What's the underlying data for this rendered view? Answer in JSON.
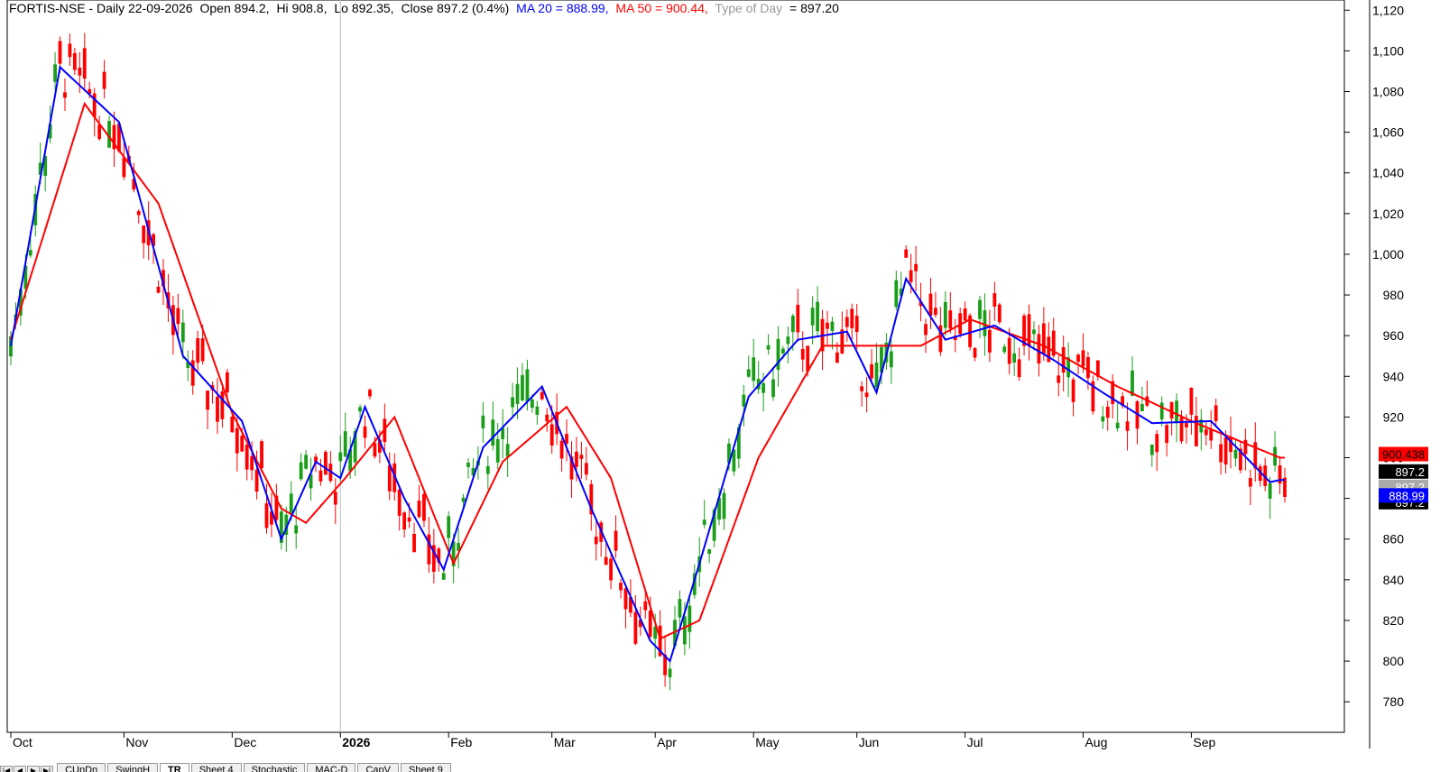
{
  "header": {
    "symbol": "FORTIS-NSE - Daily 22-09-2026",
    "open": "Open 894.2,",
    "high": "Hi 908.8,",
    "low": "Lo 892.35,",
    "close": "Close 897.2 (0.4%)",
    "ma20": "MA 20 = 888.99,",
    "ma50": "MA 50 = 900.44,",
    "tod_label": "Type of Day",
    "tod_value": "= 897.20"
  },
  "colors": {
    "up": "#1a9e1a",
    "down": "#ff0000",
    "ma20": "#0000ff",
    "ma50": "#ff0000",
    "axis": "#000000",
    "tod": "#999999"
  },
  "tabs": [
    "CUpDn",
    "SwingH",
    "TR",
    "Sheet 4",
    "Stochastic",
    "MAC-D",
    "CapV",
    "Sheet 9"
  ],
  "chart_data": {
    "type": "candlestick",
    "title": "FORTIS-NSE - Daily 22-09-2026",
    "ylim": [
      765,
      1125
    ],
    "y_ticks": [
      780,
      800,
      820,
      840,
      860,
      880,
      900,
      920,
      940,
      960,
      980,
      1000,
      1020,
      1040,
      1060,
      1080,
      1100,
      1120
    ],
    "y_tick_labels": [
      "780",
      "800",
      "820",
      "840",
      "860",
      "880",
      "900",
      "920",
      "940",
      "960",
      "980",
      "1,000",
      "1,020",
      "1,040",
      "1,060",
      "1,080",
      "1,100",
      "1,120"
    ],
    "x_month_labels": [
      {
        "label": "Oct",
        "index": 0
      },
      {
        "label": "Nov",
        "index": 23
      },
      {
        "label": "Dec",
        "index": 45
      },
      {
        "label": "2026",
        "index": 67
      },
      {
        "label": "Feb",
        "index": 89
      },
      {
        "label": "Mar",
        "index": 110
      },
      {
        "label": "Apr",
        "index": 131
      },
      {
        "label": "May",
        "index": 151
      },
      {
        "label": "Jun",
        "index": 172
      },
      {
        "label": "Jul",
        "index": 194
      },
      {
        "label": "Aug",
        "index": 218
      },
      {
        "label": "Sep",
        "index": 240
      }
    ],
    "ma_keypoints": {
      "ma20": [
        [
          0,
          955
        ],
        [
          10,
          1092
        ],
        [
          22,
          1065
        ],
        [
          35,
          950
        ],
        [
          47,
          918
        ],
        [
          55,
          860
        ],
        [
          62,
          898
        ],
        [
          67,
          890
        ],
        [
          72,
          925
        ],
        [
          80,
          880
        ],
        [
          88,
          845
        ],
        [
          96,
          905
        ],
        [
          108,
          935
        ],
        [
          118,
          875
        ],
        [
          130,
          810
        ],
        [
          134,
          800
        ],
        [
          140,
          848
        ],
        [
          150,
          930
        ],
        [
          160,
          958
        ],
        [
          170,
          962
        ],
        [
          176,
          932
        ],
        [
          182,
          988
        ],
        [
          190,
          958
        ],
        [
          200,
          965
        ],
        [
          212,
          948
        ],
        [
          222,
          932
        ],
        [
          232,
          917
        ],
        [
          244,
          918
        ],
        [
          256,
          888
        ],
        [
          258,
          889
        ]
      ],
      "ma50": [
        [
          0,
          958
        ],
        [
          15,
          1074
        ],
        [
          30,
          1025
        ],
        [
          45,
          922
        ],
        [
          55,
          875
        ],
        [
          60,
          868
        ],
        [
          68,
          890
        ],
        [
          78,
          920
        ],
        [
          90,
          848
        ],
        [
          100,
          898
        ],
        [
          113,
          925
        ],
        [
          122,
          890
        ],
        [
          132,
          811
        ],
        [
          140,
          820
        ],
        [
          152,
          900
        ],
        [
          165,
          955
        ],
        [
          175,
          955
        ],
        [
          185,
          955
        ],
        [
          195,
          968
        ],
        [
          210,
          955
        ],
        [
          225,
          935
        ],
        [
          240,
          918
        ],
        [
          258,
          900
        ]
      ]
    },
    "series": [
      {
        "name": "MA 20",
        "last_value": 888.99
      },
      {
        "name": "MA 50",
        "last_value": 900.44
      }
    ],
    "last_close": 897.2,
    "price_labels": [
      "900.438",
      "897.2",
      "897.2",
      "897.2",
      "888.99"
    ]
  }
}
